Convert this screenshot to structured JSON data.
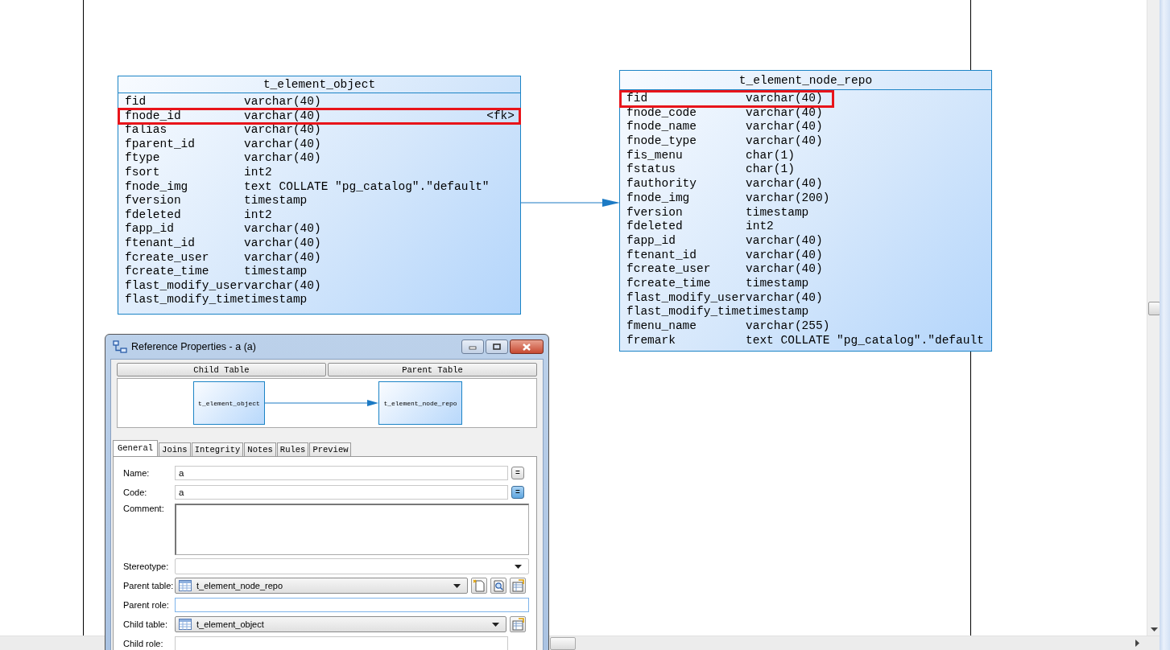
{
  "diagram": {
    "tables": [
      {
        "title": "t_element_object",
        "columns": [
          {
            "name": "fid",
            "type": "varchar(40)",
            "highlighted": false
          },
          {
            "name": "fnode_id",
            "type": "varchar(40)",
            "key": "<fk>",
            "highlighted": true
          },
          {
            "name": "falias",
            "type": "varchar(40)",
            "highlighted": false
          },
          {
            "name": "fparent_id",
            "type": "varchar(40)",
            "highlighted": false
          },
          {
            "name": "ftype",
            "type": "varchar(40)",
            "highlighted": false
          },
          {
            "name": "fsort",
            "type": "int2",
            "highlighted": false
          },
          {
            "name": "fnode_img",
            "type": "text COLLATE \"pg_catalog\".\"default\"",
            "highlighted": false
          },
          {
            "name": "fversion",
            "type": "timestamp",
            "highlighted": false
          },
          {
            "name": "fdeleted",
            "type": "int2",
            "highlighted": false
          },
          {
            "name": "fapp_id",
            "type": "varchar(40)",
            "highlighted": false
          },
          {
            "name": "ftenant_id",
            "type": "varchar(40)",
            "highlighted": false
          },
          {
            "name": "fcreate_user",
            "type": "varchar(40)",
            "highlighted": false
          },
          {
            "name": "fcreate_time",
            "type": "timestamp",
            "highlighted": false
          },
          {
            "name": "flast_modify_user",
            "type": "varchar(40)",
            "highlighted": false
          },
          {
            "name": "flast_modify_time",
            "type": "timestamp",
            "highlighted": false
          }
        ]
      },
      {
        "title": "t_element_node_repo",
        "columns": [
          {
            "name": "fid",
            "type": "varchar(40)",
            "highlighted": true
          },
          {
            "name": "fnode_code",
            "type": "varchar(40)",
            "highlighted": false
          },
          {
            "name": "fnode_name",
            "type": "varchar(40)",
            "highlighted": false
          },
          {
            "name": "fnode_type",
            "type": "varchar(40)",
            "highlighted": false
          },
          {
            "name": "fis_menu",
            "type": "char(1)",
            "highlighted": false
          },
          {
            "name": "fstatus",
            "type": "char(1)",
            "highlighted": false
          },
          {
            "name": "fauthority",
            "type": "varchar(40)",
            "highlighted": false
          },
          {
            "name": "fnode_img",
            "type": "varchar(200)",
            "highlighted": false
          },
          {
            "name": "fversion",
            "type": "timestamp",
            "highlighted": false
          },
          {
            "name": "fdeleted",
            "type": "int2",
            "highlighted": false
          },
          {
            "name": "fapp_id",
            "type": "varchar(40)",
            "highlighted": false
          },
          {
            "name": "ftenant_id",
            "type": "varchar(40)",
            "highlighted": false
          },
          {
            "name": "fcreate_user",
            "type": "varchar(40)",
            "highlighted": false
          },
          {
            "name": "fcreate_time",
            "type": "timestamp",
            "highlighted": false
          },
          {
            "name": "flast_modify_user",
            "type": "varchar(40)",
            "highlighted": false
          },
          {
            "name": "flast_modify_time",
            "type": "timestamp",
            "highlighted": false
          },
          {
            "name": "fmenu_name",
            "type": "varchar(255)",
            "highlighted": false
          },
          {
            "name": "fremark",
            "type": "text COLLATE \"pg_catalog\".\"default",
            "highlighted": false
          }
        ]
      }
    ]
  },
  "dialog": {
    "title": "Reference Properties - a (a)",
    "headers": [
      "Child Table",
      "Parent Table"
    ],
    "preview": {
      "child": "t_element_object",
      "parent": "t_element_node_repo"
    },
    "tabs": [
      {
        "label": "General",
        "selected": true
      },
      {
        "label": "Joins",
        "selected": false
      },
      {
        "label": "Integrity",
        "selected": false
      },
      {
        "label": "Notes",
        "selected": false
      },
      {
        "label": "Rules",
        "selected": false
      },
      {
        "label": "Preview",
        "selected": false
      }
    ],
    "fields": [
      {
        "kind": "text",
        "label": "Name:",
        "value": "a",
        "buttons": [
          {
            "kind": "equals",
            "label": "=",
            "pressed": false
          }
        ]
      },
      {
        "kind": "text",
        "label": "Code:",
        "value": "a",
        "buttons": [
          {
            "kind": "equals",
            "label": "=",
            "pressed": true
          }
        ]
      },
      {
        "kind": "memo",
        "label": "Comment:"
      },
      {
        "kind": "combo",
        "label": "Stereotype:"
      },
      {
        "kind": "table-combo",
        "label": "Parent table:",
        "value": "t_element_node_repo",
        "buttons": [
          {
            "kind": "new"
          },
          {
            "kind": "browse"
          },
          {
            "kind": "properties"
          }
        ]
      },
      {
        "kind": "text",
        "label": "Parent role:",
        "focused": true
      },
      {
        "kind": "table-combo",
        "label": "Child table:",
        "value": "t_element_object",
        "buttons": [
          {
            "kind": "properties"
          }
        ]
      },
      {
        "kind": "text",
        "label": "Child role:"
      }
    ]
  }
}
